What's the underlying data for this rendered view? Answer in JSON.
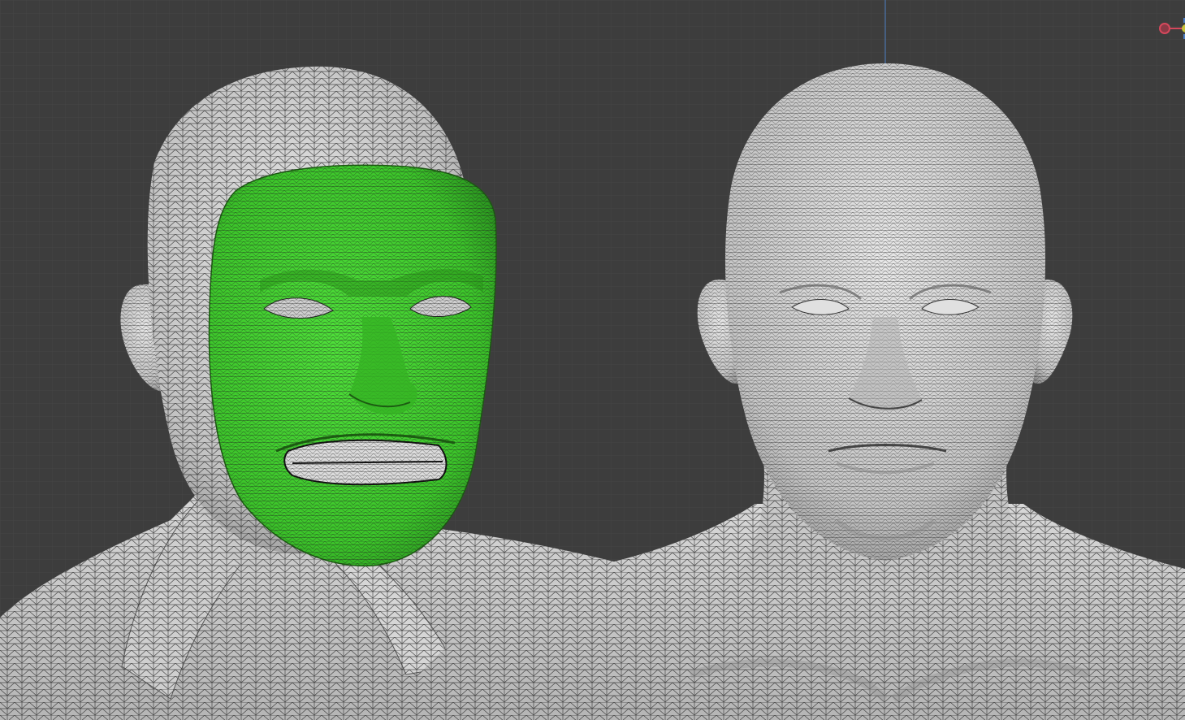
{
  "app": {
    "view": "3D Viewport",
    "shading": "solid-wireframe"
  },
  "colors": {
    "background": "#3d3d3d",
    "grid_line": "#454545",
    "z_axis": "#4d7fc4",
    "x_axis": "#d5485c",
    "y_axis": "#c7c23a",
    "mesh_base": "#d4d4d4",
    "mesh_shadow": "#8e8e8e",
    "wire": "#1e1e1e",
    "mask_fill": "#3fcc2c",
    "mask_shadow": "#258a17"
  },
  "objects": [
    {
      "name": "head-shirt-body",
      "description_icon": "mesh-object-icon",
      "selected": false
    },
    {
      "name": "face-mask",
      "description_icon": "mesh-object-icon",
      "selected": true
    },
    {
      "name": "head-bare-body",
      "description_icon": "mesh-object-icon",
      "selected": false
    }
  ],
  "gizmo": {
    "icon": "navigation-gizmo-icon",
    "axis_x_label": "",
    "axis_y_label": ""
  }
}
